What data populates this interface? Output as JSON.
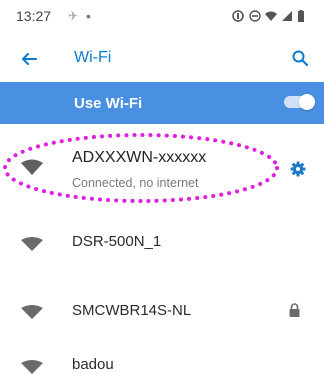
{
  "status_bar": {
    "time": "13:27",
    "dot": "•"
  },
  "toolbar": {
    "title": "Wi-Fi"
  },
  "use_wifi": {
    "label": "Use Wi-Fi",
    "enabled": true,
    "accent": "#4a90e2"
  },
  "networks": [
    {
      "name": "ADXXXWN-xxxxxx",
      "status": "Connected, no internet",
      "secured": false,
      "action_icon": "gear-icon"
    },
    {
      "name": "DSR-500N_1",
      "secured": false
    },
    {
      "name": "SMCWBR14S-NL",
      "secured": true
    },
    {
      "name": "badou",
      "secured": false
    }
  ],
  "colors": {
    "highlight": "#e020e0",
    "accent": "#0b7bd0"
  }
}
